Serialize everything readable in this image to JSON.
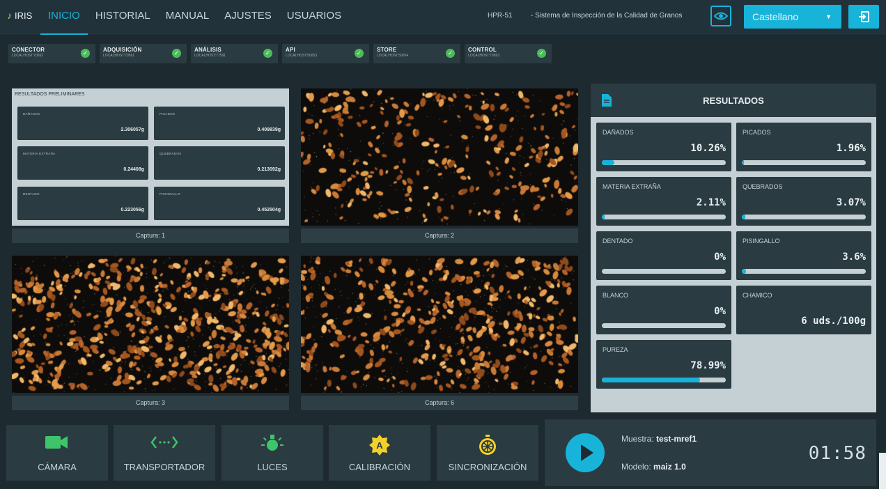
{
  "app": {
    "logo": "IRIS"
  },
  "nav": {
    "tabs": [
      {
        "label": "INICIO",
        "active": true
      },
      {
        "label": "HISTORIAL"
      },
      {
        "label": "MANUAL"
      },
      {
        "label": "AJUSTES"
      },
      {
        "label": "USUARIOS"
      }
    ]
  },
  "header": {
    "device": "HPR-51",
    "system_title": "- Sistema de Inspección de la Calidad de Granos",
    "language": "Castellano"
  },
  "services": [
    {
      "name": "CONECTOR",
      "address": "LOCALHOST:70562",
      "status": "ok"
    },
    {
      "name": "ADQUISICIÓN",
      "address": "LOCALHOST:70561",
      "status": "ok"
    },
    {
      "name": "ANÁLISIS",
      "address": "LOCALHOST:77591",
      "status": "ok"
    },
    {
      "name": "API",
      "address": "LOCALHOST:50053",
      "status": "ok"
    },
    {
      "name": "STORE",
      "address": "LOCALHOST:50054",
      "status": "ok"
    },
    {
      "name": "CONTROL",
      "address": "LOCALHOST:70563",
      "status": "ok"
    }
  ],
  "preliminary": {
    "title": "RESULTADOS PRELIMINARES",
    "items": [
      {
        "label": "DAÑADOS",
        "value": "2.306057g"
      },
      {
        "label": "PICADOS",
        "value": "0.409839g"
      },
      {
        "label": "MATERIA EXTRAÑA",
        "value": "0.24408g"
      },
      {
        "label": "QUEBRADOS",
        "value": "0.213092g"
      },
      {
        "label": "DENTADO",
        "value": "0.223056g"
      },
      {
        "label": "PISINGALLO",
        "value": "0.452504g"
      }
    ]
  },
  "captures": [
    {
      "label": "Captura: 1"
    },
    {
      "label": "Captura: 2"
    },
    {
      "label": "Captura: 3"
    },
    {
      "label": "Captura: 6"
    }
  ],
  "results": {
    "title": "RESULTADOS",
    "items": [
      {
        "label": "DAÑADOS",
        "value": "10.26%",
        "fraction": 0.1026
      },
      {
        "label": "PICADOS",
        "value": "1.96%",
        "fraction": 0.0196
      },
      {
        "label": "MATERIA EXTRAÑA",
        "value": "2.11%",
        "fraction": 0.0211
      },
      {
        "label": "QUEBRADOS",
        "value": "3.07%",
        "fraction": 0.0307
      },
      {
        "label": "DENTADO",
        "value": "0%",
        "fraction": 0
      },
      {
        "label": "PISINGALLO",
        "value": "3.6%",
        "fraction": 0.036
      },
      {
        "label": "BLANCO",
        "value": "0%",
        "fraction": 0
      },
      {
        "label": "CHAMICO",
        "value": "6 uds./100g"
      },
      {
        "label": "PUREZA",
        "value": "78.99%",
        "fraction": 0.7899
      }
    ]
  },
  "controls": [
    {
      "label": "CÁMARA",
      "icon": "camera-icon"
    },
    {
      "label": "TRANSPORTADOR",
      "icon": "conveyor-icon"
    },
    {
      "label": "LUCES",
      "icon": "light-bulb-icon"
    },
    {
      "label": "CALIBRACIÓN",
      "icon": "calibration-icon"
    },
    {
      "label": "SINCRONIZACIÓN",
      "icon": "sync-timer-icon"
    }
  ],
  "run": {
    "sample_label": "Muestra:",
    "sample_value": "test-mref1",
    "model_label": "Modelo:",
    "model_value": "maiz 1.0",
    "timer": "01:58"
  },
  "colors": {
    "accent": "#17b3d9",
    "ok": "#4cbb5a",
    "panel": "#2b3b42",
    "background": "#1d2a30",
    "light_panel": "#c5d0d4",
    "camera_icon": "#3ec56a",
    "calibration_icon": "#f3cf2a"
  }
}
